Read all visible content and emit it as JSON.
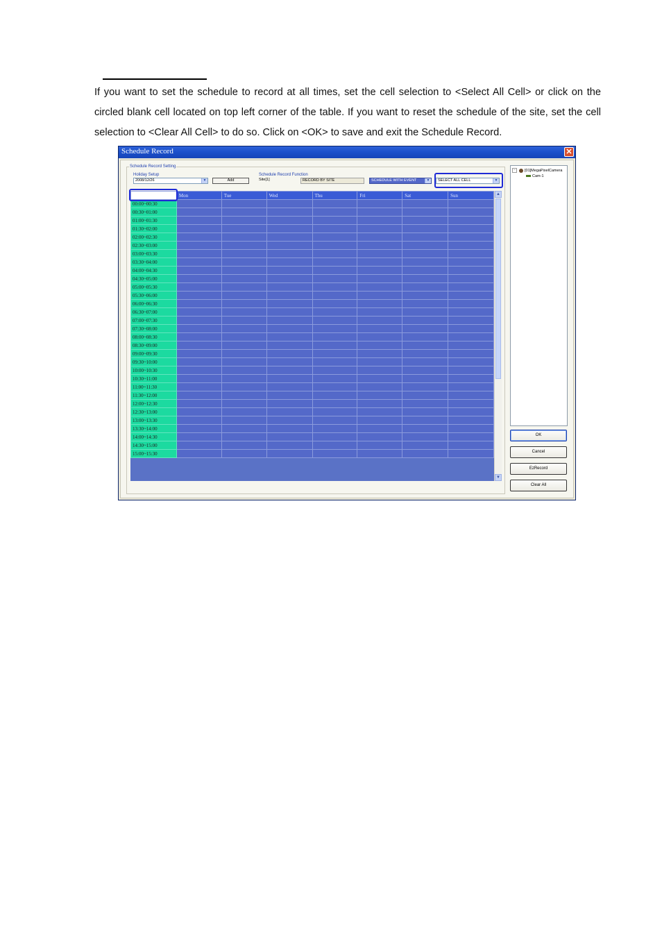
{
  "document": {
    "paragraph": "If you want to set the schedule to record at all times, set the cell selection to <Select All Cell> or click on the circled blank cell located on top left corner of the table. If you want to reset the schedule of the site, set the cell selection to <Clear All Cell> to do so. Click on <OK> to save and exit the Schedule Record."
  },
  "window": {
    "title": "Schedule Record",
    "close_icon": "close-icon"
  },
  "settings": {
    "group_label": "Schedule Record Setting",
    "holiday_label": "Holiday Setup",
    "holiday_value": "2008/12/26",
    "add_label": "Add",
    "function_label": "Schedule Record Function",
    "site_label": "Site[1]",
    "record_mode": "RECORD BY SITE",
    "schedule_mode": "SCHEDULE WITH EVENT",
    "cell_selection": "SELECT ALL CELL"
  },
  "grid": {
    "days": [
      "Mon",
      "Tue",
      "Wed",
      "Thu",
      "Fri",
      "Sat",
      "Sun"
    ],
    "times": [
      "00:00~00:30",
      "00:30~01:00",
      "01:00~01:30",
      "01:30~02:00",
      "02:00~02:30",
      "02:30~03:00",
      "03:00~03:30",
      "03:30~04:00",
      "04:00~04:30",
      "04:30~05:00",
      "05:00~05:30",
      "05:30~06:00",
      "06:00~06:30",
      "06:30~07:00",
      "07:00~07:30",
      "07:30~08:00",
      "08:00~08:30",
      "08:30~09:00",
      "09:00~09:30",
      "09:30~10:00",
      "10:00~10:30",
      "10:30~11:00",
      "11:00~11:30",
      "11:30~12:00",
      "12:00~12:30",
      "12:30~13:00",
      "13:00~13:30",
      "13:30~14:00",
      "14:00~14:30",
      "14:30~15:00",
      "15:00~15:30"
    ]
  },
  "tree": {
    "root": "[01]MegaPixelCamera",
    "child": "Cam-1"
  },
  "buttons": {
    "ok": "OK",
    "cancel": "Cancel",
    "ezrecord": "EzRecord",
    "clear_all": "Clear All"
  },
  "colors": {
    "titlebar": "#1c4fc9",
    "time_column": "#1cdaa0",
    "selected_cell": "#5469c9",
    "highlight": "#1f2bd6"
  }
}
